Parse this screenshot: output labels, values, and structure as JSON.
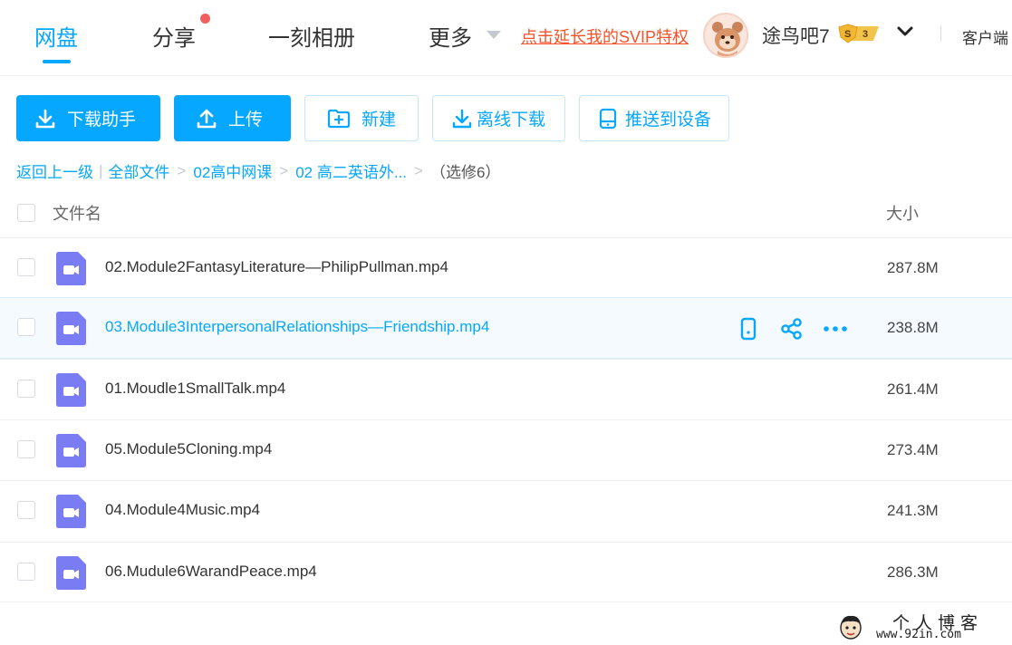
{
  "nav": {
    "items": [
      "网盘",
      "分享",
      "一刻相册",
      "更多"
    ],
    "svip_promo": "点击延长我的SVIP特权",
    "username": "途鸟吧7",
    "vip_level": "3",
    "vip_symbol": "S",
    "client": "客户端"
  },
  "toolbar": {
    "download_helper": "下载助手",
    "upload": "上传",
    "new_folder": "新建",
    "offline_download": "离线下载",
    "push_device": "推送到设备"
  },
  "breadcrumb": {
    "back": "返回上一级",
    "all_files": "全部文件",
    "level1": "02高中网课",
    "level2": "02 高二英语外...",
    "current": "（选修6）"
  },
  "table": {
    "col_name": "文件名",
    "col_size": "大小",
    "rows": [
      {
        "name": "02.Module2FantasyLiterature—PhilipPullman.mp4",
        "size": "287.8M"
      },
      {
        "name": "03.Module3InterpersonalRelationships—Friendship.mp4",
        "size": "238.8M"
      },
      {
        "name": "01.Moudle1SmallTalk.mp4",
        "size": "261.4M"
      },
      {
        "name": "05.Module5Cloning.mp4",
        "size": "273.4M"
      },
      {
        "name": "04.Module4Music.mp4",
        "size": "241.3M"
      },
      {
        "name": "06.Mudule6WarandPeace.mp4",
        "size": "286.3M"
      }
    ]
  },
  "watermark": {
    "title": "个人博客",
    "url": "www.92in.com"
  },
  "colors": {
    "accent": "#06a7ff",
    "promo": "#f5532a",
    "video_icon": "#7a7cf3"
  }
}
